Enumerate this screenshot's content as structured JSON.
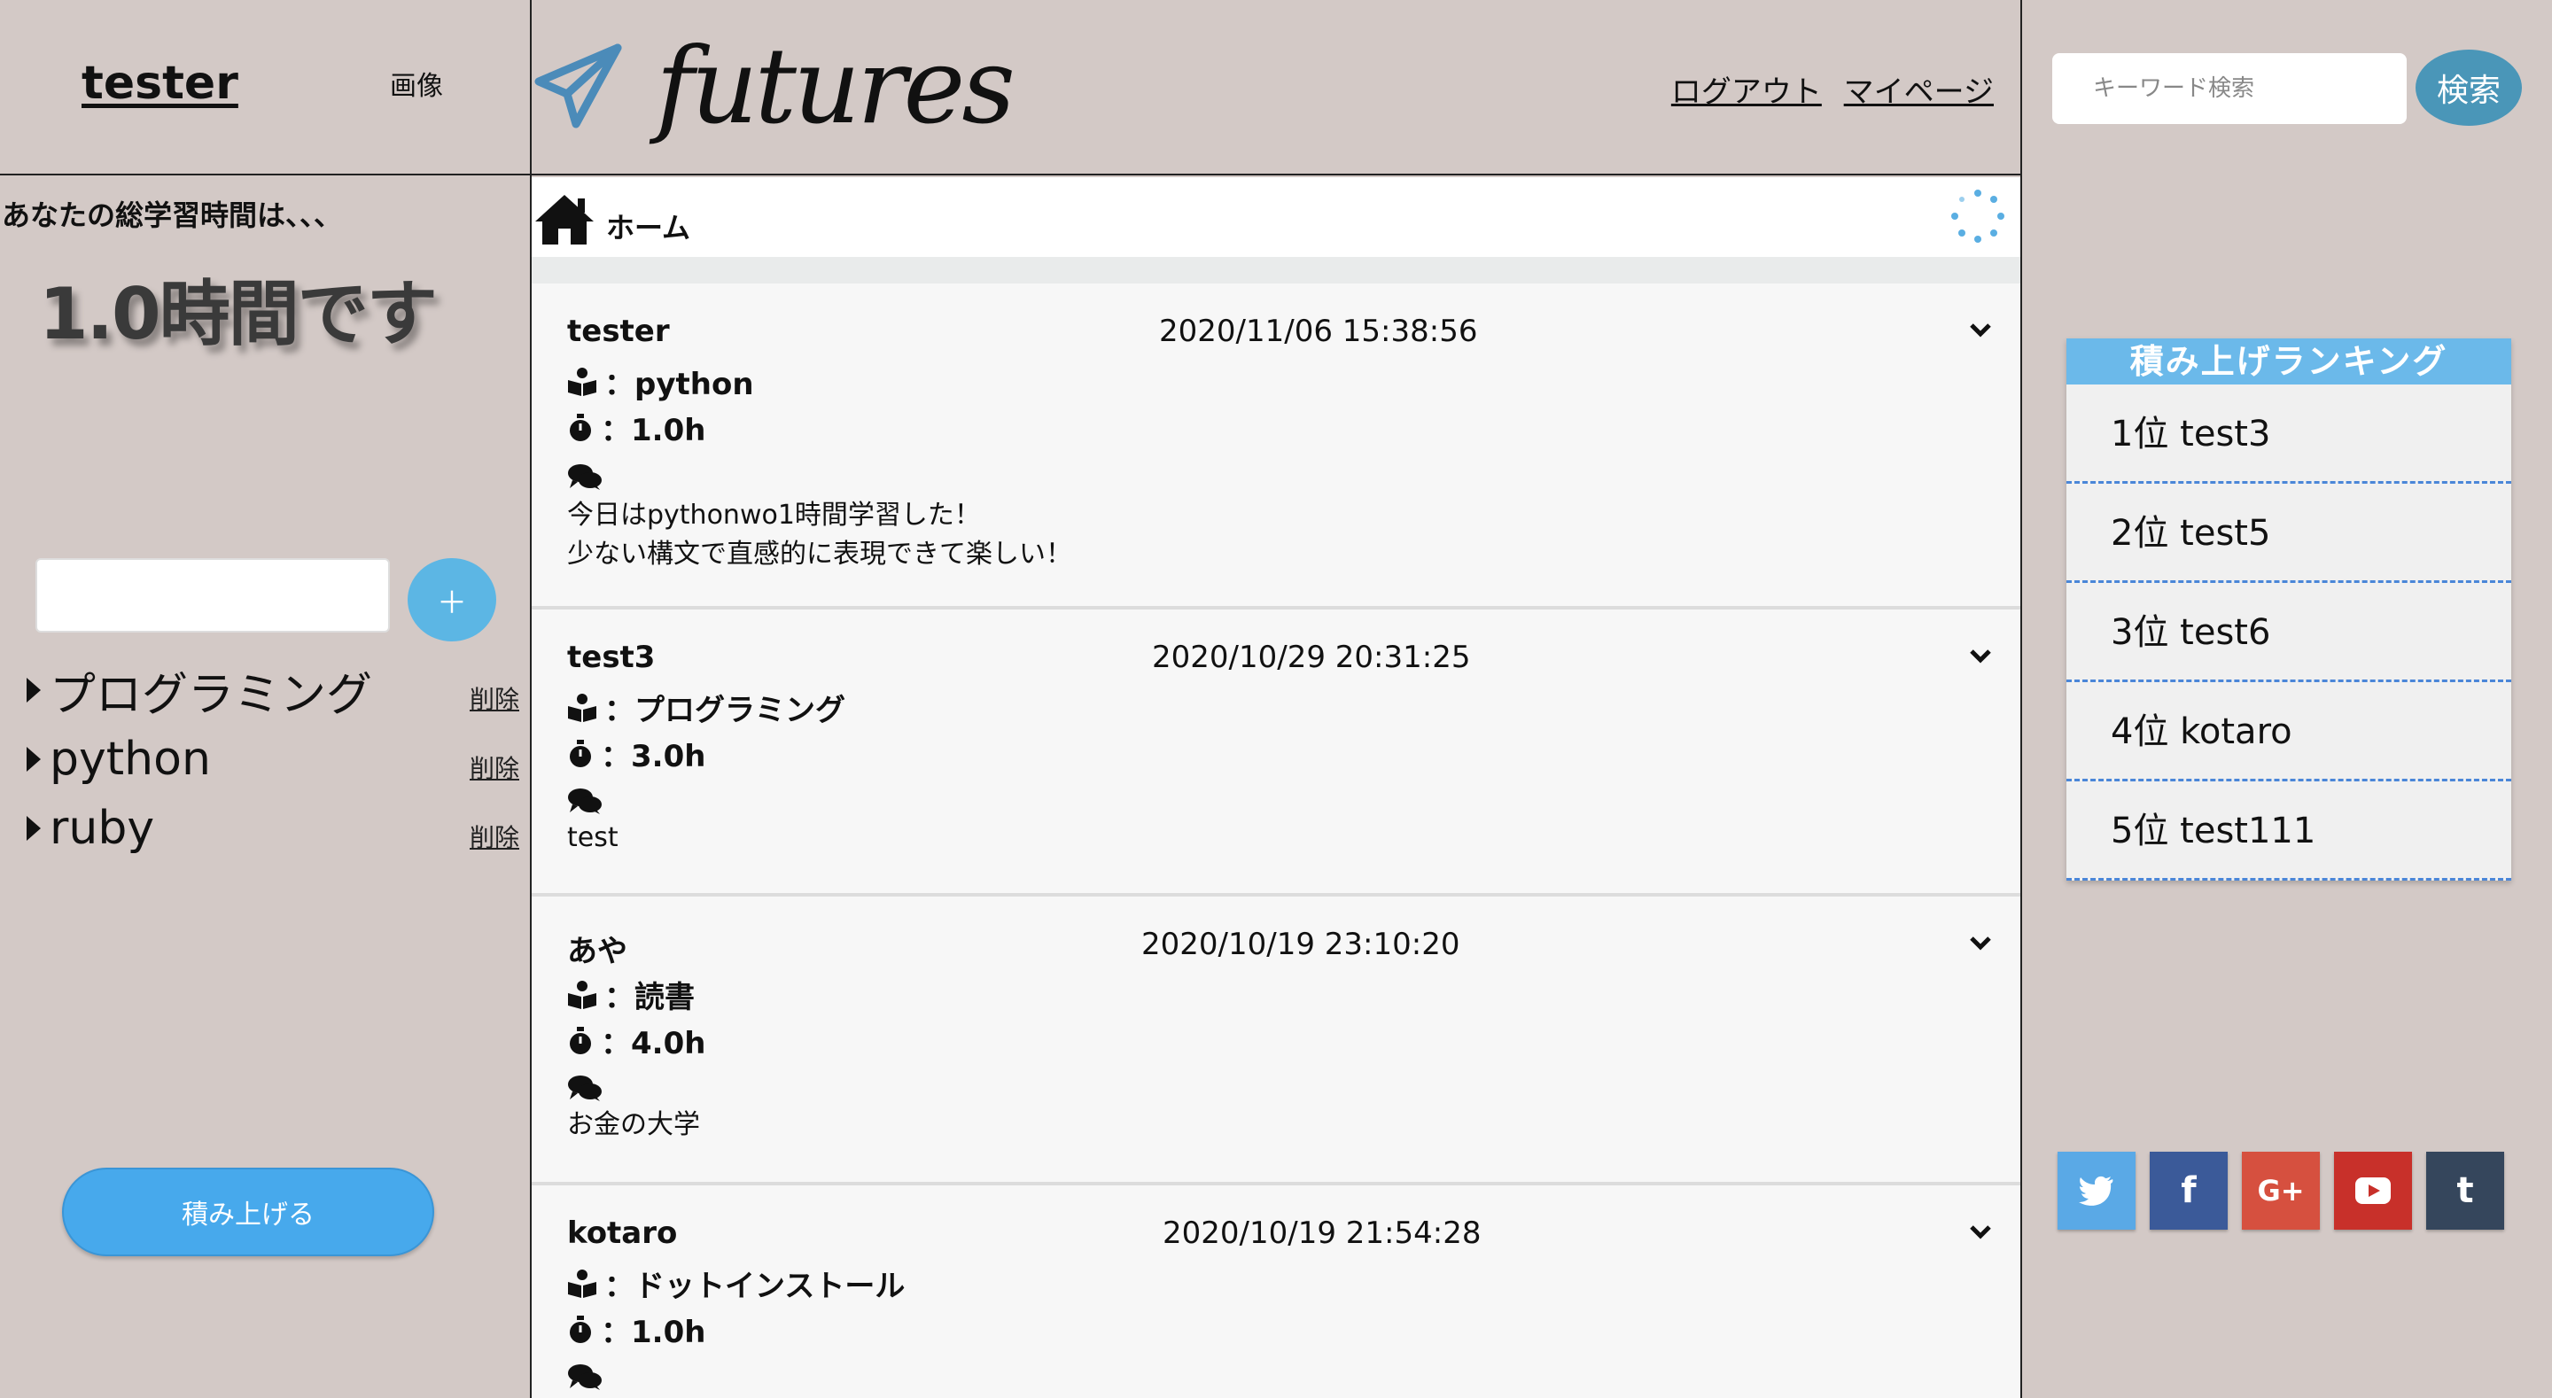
{
  "left": {
    "username": "tester",
    "image_link": "画像",
    "total_label": "あなたの総学習時間は、、、",
    "total_value": "1.0時間です",
    "category_input": {
      "value": "",
      "placeholder": ""
    },
    "add_button": "＋",
    "categories": [
      {
        "name": "プログラミング",
        "delete": "削除"
      },
      {
        "name": "python",
        "delete": "削除"
      },
      {
        "name": "ruby",
        "delete": "削除"
      }
    ],
    "stack_button": "積み上げる"
  },
  "header": {
    "logo": "futures",
    "logout": "ログアウト",
    "mypage": "マイページ"
  },
  "home": {
    "label": "ホーム"
  },
  "posts": [
    {
      "user": "tester",
      "date": "2020/11/06 15:38:56",
      "category": "：python",
      "hours": "：1.0h",
      "body_lines": [
        "今日はpythonwo1時間学習した！",
        "少ない構文で直感的に表現できて楽しい！"
      ]
    },
    {
      "user": "test3",
      "date": "2020/10/29 20:31:25",
      "category": "：プログラミング",
      "hours": "：3.0h",
      "body_lines": [
        "test"
      ]
    },
    {
      "user": "あや",
      "date": "2020/10/19 23:10:20",
      "category": "：読書",
      "hours": "：4.0h",
      "body_lines": [
        "お金の大学"
      ]
    },
    {
      "user": "kotaro",
      "date": "2020/10/19 21:54:28",
      "category": "：ドットインストール",
      "hours": "：1.0h",
      "body_lines": []
    }
  ],
  "search": {
    "placeholder": "キーワード検索",
    "value": "",
    "button": "検索"
  },
  "ranking": {
    "title": "積み上げランキング",
    "items": [
      "1位 test3",
      "2位 test5",
      "3位 test6",
      "4位 kotaro",
      "5位 test111"
    ]
  },
  "social": [
    {
      "name": "twitter",
      "glyph": "t",
      "color": "#5aa9e6"
    },
    {
      "name": "facebook",
      "glyph": "f",
      "color": "#3b5a99"
    },
    {
      "name": "google-plus",
      "glyph": "G+",
      "color": "#d6503f"
    },
    {
      "name": "youtube",
      "glyph": "▶",
      "color": "#c8302a"
    },
    {
      "name": "tumblr",
      "glyph": "t",
      "color": "#35465c"
    }
  ],
  "colors": {
    "background": "#d3c9c6",
    "accent_blue": "#47a9ec",
    "ranking_header": "#6bb9ea",
    "search_button": "#4a96b8"
  }
}
